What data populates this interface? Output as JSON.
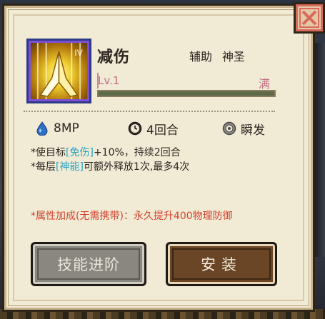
{
  "skill": {
    "name": "减伤",
    "tags": [
      "辅助",
      "神圣"
    ],
    "level_label": "Lv.1",
    "max_label": "满",
    "level_progress": 1.0,
    "icon": "praying-hands-icon"
  },
  "stats": {
    "mp": "8MP",
    "mp_icon": "water-drop-icon",
    "turns": "4回合",
    "turns_icon": "clock-icon",
    "cast": "瞬发",
    "cast_icon": "instant-cast-icon"
  },
  "description": {
    "line1_prefix": "*使目标",
    "line1_keyword": "[免伤]",
    "line1_suffix": "+10%，持续2回合",
    "line2_prefix": "*每层",
    "line2_keyword": "[神能]",
    "line2_suffix": "可额外释放1次,最多4次"
  },
  "attribute_bonus": "*属性加成(无需携带)：永久提升400物理防御",
  "buttons": {
    "advance": "技能进阶",
    "install": "安装"
  },
  "colors": {
    "panel_bg": "#f1ead5",
    "keyword": "#2aa3c0",
    "attribute_text": "#d5442e",
    "level_text": "#c06f83",
    "advance_button": "#8a8780",
    "install_button": "#6a4526",
    "close_button": "#e4c9a8"
  },
  "close_icon": "close-icon"
}
